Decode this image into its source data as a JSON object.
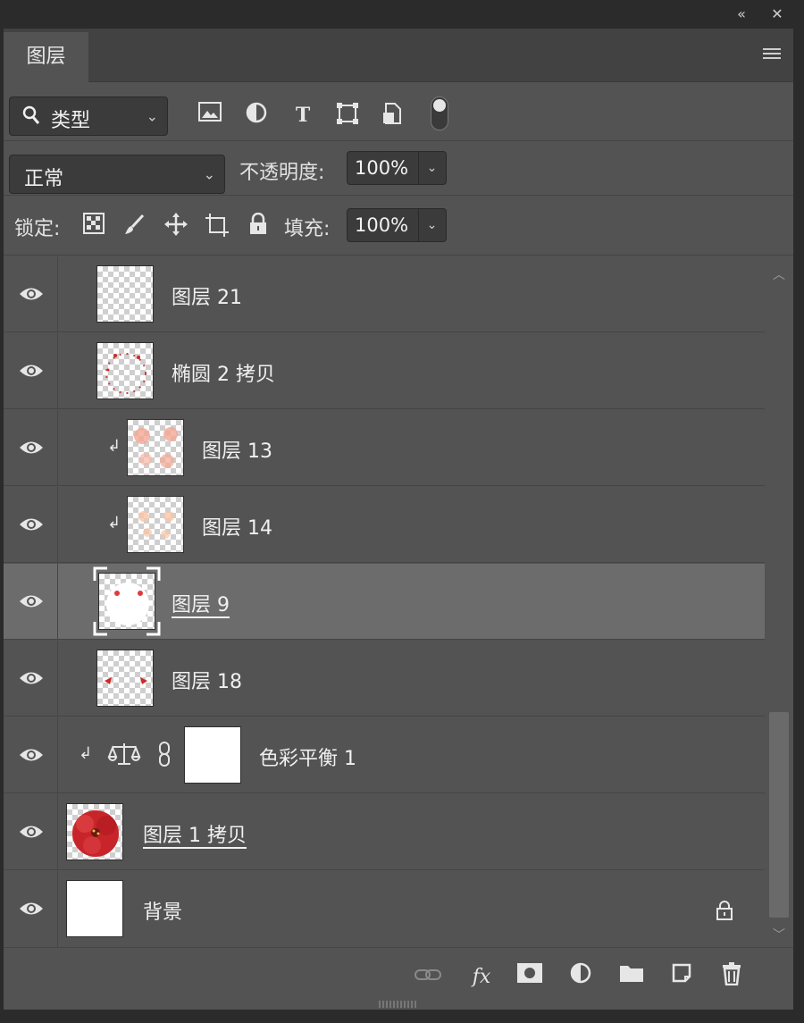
{
  "panel_bar": {
    "collapse_icon": "double-chevron-left-icon",
    "close_icon": "close-icon"
  },
  "tabs": [
    {
      "label": "图层"
    }
  ],
  "filter": {
    "kind_value": "类型",
    "icons": [
      "image-filter-icon",
      "adjustment-filter-icon",
      "type-filter-icon",
      "shape-filter-icon",
      "smart-object-filter-icon"
    ]
  },
  "blend": {
    "mode": "正常",
    "opacity_label": "不透明度:",
    "opacity_value": "100%"
  },
  "lock": {
    "label": "锁定:",
    "fill_label": "填充:",
    "fill_value": "100%"
  },
  "layers": [
    {
      "name": "图层 21"
    },
    {
      "name": "椭圆 2 拷贝"
    },
    {
      "name": "图层 13"
    },
    {
      "name": "图层 14"
    },
    {
      "name": "图层 9"
    },
    {
      "name": "图层 18"
    },
    {
      "name": "色彩平衡 1"
    },
    {
      "name": "图层 1 拷贝"
    },
    {
      "name": "背景"
    }
  ],
  "footer_icons": [
    "link-icon",
    "fx-icon",
    "mask-icon",
    "adjustment-layer-icon",
    "group-folder-icon",
    "new-layer-icon",
    "trash-icon"
  ],
  "colors": {
    "panel_bg": "#535353",
    "selected_row": "#6c6c6c",
    "field_bg": "#3b3b3b"
  }
}
